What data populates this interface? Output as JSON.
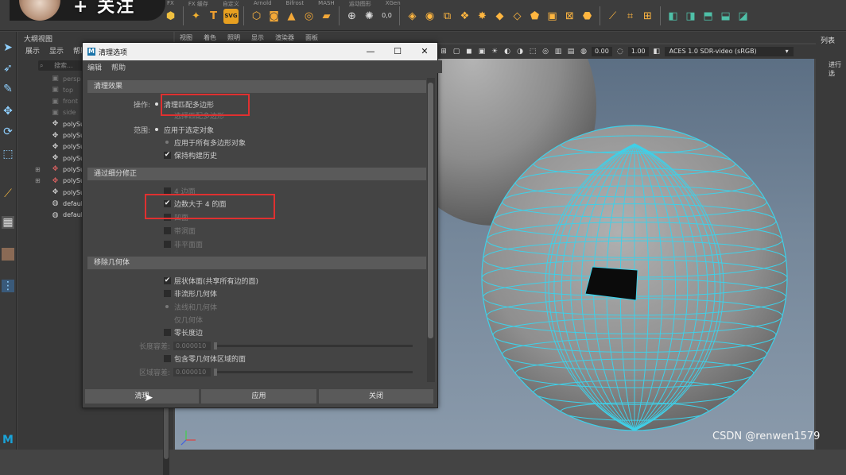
{
  "overlay": {
    "follow_text": "+ 关注"
  },
  "shelf": {
    "tabs": [
      "FX",
      "FX 缓存",
      "自定义",
      "Arnold",
      "Bifrost",
      "MASH",
      "运动图形",
      "XGen"
    ],
    "icons": [
      "polygon-sphere",
      "star-icon",
      "text-icon",
      "svg-icon",
      "cube-icon",
      "cylinder-icon",
      "cone-icon",
      "torus-icon",
      "plane-icon"
    ]
  },
  "outliner": {
    "title": "大纲视图",
    "menu": [
      "展示",
      "显示",
      "帮助"
    ],
    "search_placeholder": "搜索...",
    "items": [
      {
        "label": "persp",
        "kind": "camera"
      },
      {
        "label": "top",
        "kind": "camera"
      },
      {
        "label": "front",
        "kind": "camera"
      },
      {
        "label": "side",
        "kind": "camera"
      },
      {
        "label": "polySurf",
        "kind": "mesh"
      },
      {
        "label": "polySurf",
        "kind": "mesh"
      },
      {
        "label": "polySurf",
        "kind": "mesh"
      },
      {
        "label": "polySurf",
        "kind": "mesh"
      },
      {
        "label": "polySurf",
        "kind": "group"
      },
      {
        "label": "polySurf",
        "kind": "group"
      },
      {
        "label": "polySurf",
        "kind": "mesh"
      },
      {
        "label": "defaultLi",
        "kind": "set"
      },
      {
        "label": "defaultO",
        "kind": "set"
      }
    ]
  },
  "viewport": {
    "menu": [
      "视图",
      "着色",
      "照明",
      "显示",
      "渲染器",
      "面板"
    ],
    "exposure": "0.00",
    "gamma": "1.00",
    "color_space": "ACES 1.0 SDR-video (sRGB)"
  },
  "right_panel": {
    "tab_label": "列表",
    "sub_label": "进行选"
  },
  "dialog": {
    "title": "清理选项",
    "logo": "M",
    "menu": [
      "编辑",
      "帮助"
    ],
    "sections": {
      "cleanup_effect": "清理效果",
      "fix_by_tessellation": "通过细分修正",
      "remove_geometry": "移除几何体"
    },
    "operation": {
      "label": "操作:",
      "options": [
        "清理匹配多边形",
        "选择匹配多边形"
      ],
      "selected": 0
    },
    "scope": {
      "label": "范围:",
      "options": [
        "应用于选定对象",
        "应用于所有多边形对象"
      ],
      "selected": 0
    },
    "keep_history": {
      "label": "保持构建历史",
      "checked": true
    },
    "tessellation": [
      {
        "label": "4 边面",
        "checked": false
      },
      {
        "label": "边数大于 4 的面",
        "checked": true
      },
      {
        "label": "凹面",
        "checked": false
      },
      {
        "label": "带洞面",
        "checked": false
      },
      {
        "label": "非平面面",
        "checked": false
      }
    ],
    "remove": [
      {
        "label": "层状体面(共享所有边的面)",
        "checked": true
      },
      {
        "label": "非流形几何体",
        "checked": false
      }
    ],
    "nonmanifold_options": [
      "法线和几何体",
      "仅几何体"
    ],
    "zero_length_edges": {
      "label": "零长度边",
      "checked": false
    },
    "length_tolerance": {
      "label": "长度容差:",
      "value": "0.000010"
    },
    "zero_geometry_area": {
      "label": "包含零几何体区域的面",
      "checked": false
    },
    "area_tolerance": {
      "label": "区域容差:",
      "value": "0.000010"
    },
    "buttons": {
      "cleanup": "清理",
      "apply": "应用",
      "close": "关闭"
    }
  },
  "watermark": "CSDN @renwen1579",
  "colors": {
    "accent_red": "#e03030",
    "wire_cyan": "#3fd0e8",
    "maya_blue": "#1a73a8"
  }
}
